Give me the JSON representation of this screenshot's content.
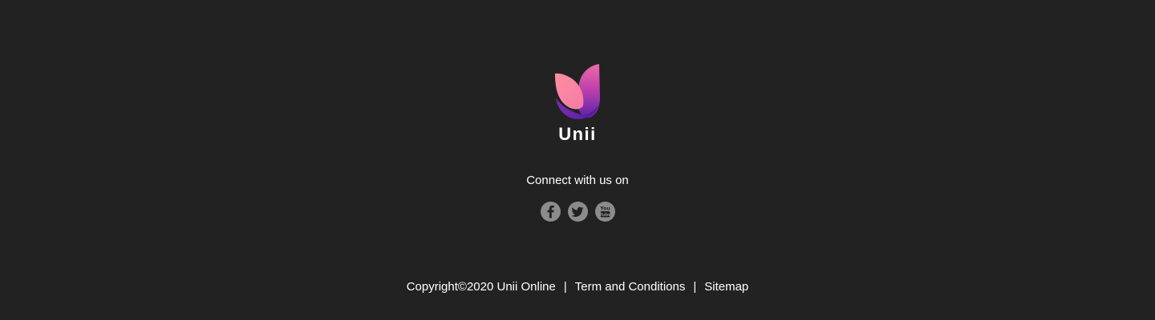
{
  "brand": {
    "name": "Unii",
    "gradient_start": "#ff8aa1",
    "gradient_mid": "#d04ea6",
    "gradient_end": "#5a1fa8"
  },
  "connect": {
    "heading": "Connect with us on",
    "icons": [
      "facebook-icon",
      "twitter-icon",
      "youtube-icon"
    ],
    "icon_color": "#8c8c8c"
  },
  "footer": {
    "copyright": "Copyright©2020 Unii Online",
    "separator": "|",
    "terms_label": "Term and Conditions",
    "sitemap_label": "Sitemap"
  },
  "colors": {
    "background": "#222222",
    "text": "#ffffff"
  }
}
